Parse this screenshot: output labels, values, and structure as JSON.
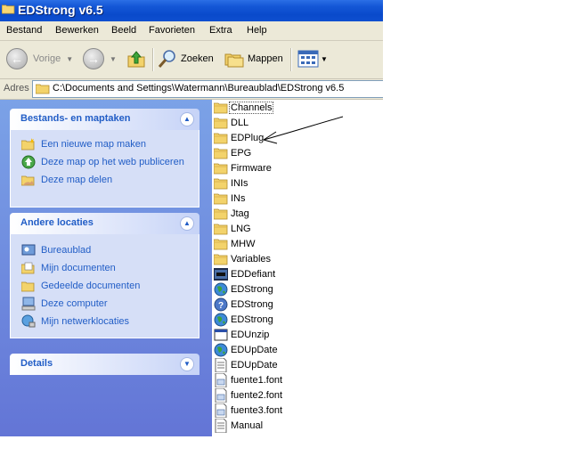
{
  "window": {
    "title": "EDStrong v6.5"
  },
  "menu": [
    "Bestand",
    "Bewerken",
    "Beeld",
    "Favorieten",
    "Extra",
    "Help"
  ],
  "toolbar": {
    "back_label": "Vorige",
    "search_label": "Zoeken",
    "folders_label": "Mappen"
  },
  "address": {
    "label": "Adres",
    "path": "C:\\Documents and Settings\\Watermann\\Bureaublad\\EDStrong v6.5"
  },
  "taskpane": {
    "file_tasks": {
      "title": "Bestands- en maptaken",
      "items": [
        "Een nieuwe map maken",
        "Deze map op het web publiceren",
        "Deze map delen"
      ]
    },
    "other_places": {
      "title": "Andere locaties",
      "items": [
        "Bureaublad",
        "Mijn documenten",
        "Gedeelde documenten",
        "Deze computer",
        "Mijn netwerklocaties"
      ]
    },
    "details": {
      "title": "Details"
    }
  },
  "files": [
    {
      "name": "Channels",
      "icon": "folder"
    },
    {
      "name": "DLL",
      "icon": "folder"
    },
    {
      "name": "EDPlug",
      "icon": "folder"
    },
    {
      "name": "EPG",
      "icon": "folder"
    },
    {
      "name": "Firmware",
      "icon": "folder"
    },
    {
      "name": "INIs",
      "icon": "folder"
    },
    {
      "name": "INs",
      "icon": "folder"
    },
    {
      "name": "Jtag",
      "icon": "folder"
    },
    {
      "name": "LNG",
      "icon": "folder"
    },
    {
      "name": "MHW",
      "icon": "folder"
    },
    {
      "name": "Variables",
      "icon": "folder"
    },
    {
      "name": "EDDefiant",
      "icon": "app-dark"
    },
    {
      "name": "EDStrong",
      "icon": "app-globe"
    },
    {
      "name": "EDStrong",
      "icon": "help-file"
    },
    {
      "name": "EDStrong",
      "icon": "app-globe"
    },
    {
      "name": "EDUnzip",
      "icon": "window-app"
    },
    {
      "name": "EDUpDate",
      "icon": "app-globe"
    },
    {
      "name": "EDUpDate",
      "icon": "text-file"
    },
    {
      "name": "fuente1.font",
      "icon": "font-file"
    },
    {
      "name": "fuente2.font",
      "icon": "font-file"
    },
    {
      "name": "fuente3.font",
      "icon": "font-file"
    },
    {
      "name": "Manual",
      "icon": "text-file"
    }
  ]
}
